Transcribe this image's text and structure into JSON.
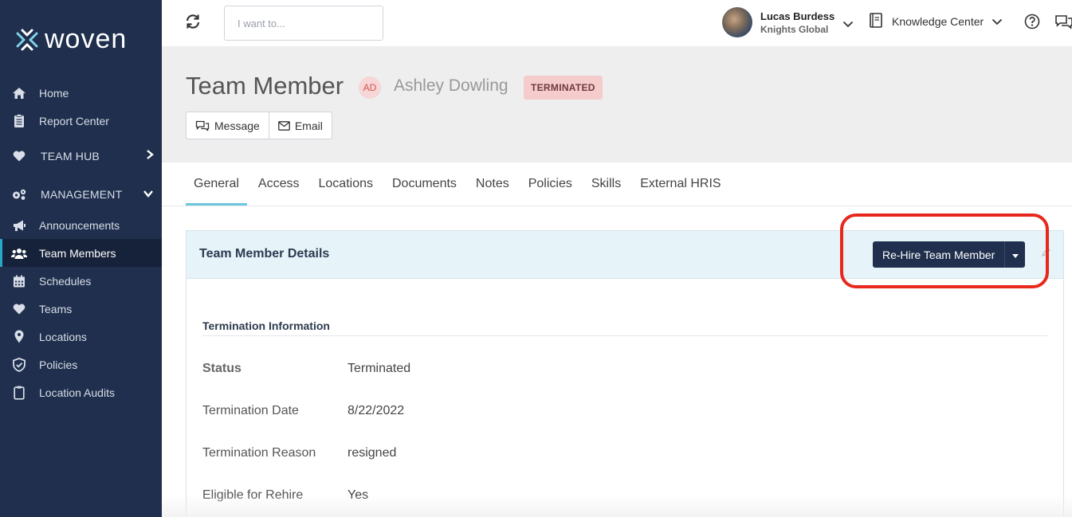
{
  "brand": {
    "name": "woven"
  },
  "sidebar": {
    "items": [
      {
        "label": "Home",
        "icon": "home-icon"
      },
      {
        "label": "Report Center",
        "icon": "clipboard-icon"
      },
      {
        "label": "TEAM HUB",
        "icon": "heart-icon"
      },
      {
        "label": "MANAGEMENT",
        "icon": "gears-icon"
      },
      {
        "label": "Announcements",
        "icon": "megaphone-icon"
      },
      {
        "label": "Team Members",
        "icon": "users-icon",
        "active": true
      },
      {
        "label": "Schedules",
        "icon": "calendar-icon"
      },
      {
        "label": "Teams",
        "icon": "heart-icon"
      },
      {
        "label": "Locations",
        "icon": "map-pin-icon"
      },
      {
        "label": "Policies",
        "icon": "shield-icon"
      },
      {
        "label": "Location Audits",
        "icon": "clipboard-icon"
      }
    ]
  },
  "topbar": {
    "search_placeholder": "I want to...",
    "user_name": "Lucas Burdess",
    "user_org": "Knights Global",
    "knowledge_center": "Knowledge Center"
  },
  "header": {
    "title": "Team Member",
    "initials": "AD",
    "member_name": "Ashley Dowling",
    "status": "TERMINATED",
    "message_label": "Message",
    "email_label": "Email"
  },
  "tabs": [
    "General",
    "Access",
    "Locations",
    "Documents",
    "Notes",
    "Policies",
    "Skills",
    "External HRIS"
  ],
  "panel": {
    "title": "Team Member Details",
    "rehire_label": "Re-Hire Team Member",
    "section_title": "Termination Information",
    "rows": [
      {
        "label": "Status",
        "value": "Terminated"
      },
      {
        "label": "Termination Date",
        "value": "8/22/2022"
      },
      {
        "label": "Termination Reason",
        "value": "resigned"
      },
      {
        "label": "Eligible for Rehire",
        "value": "Yes"
      }
    ]
  },
  "colors": {
    "sidebar_bg": "#1f2f4d",
    "accent": "#6cc6dc",
    "highlight": "#e8281c",
    "status_tag_bg": "#f6cbcb"
  }
}
